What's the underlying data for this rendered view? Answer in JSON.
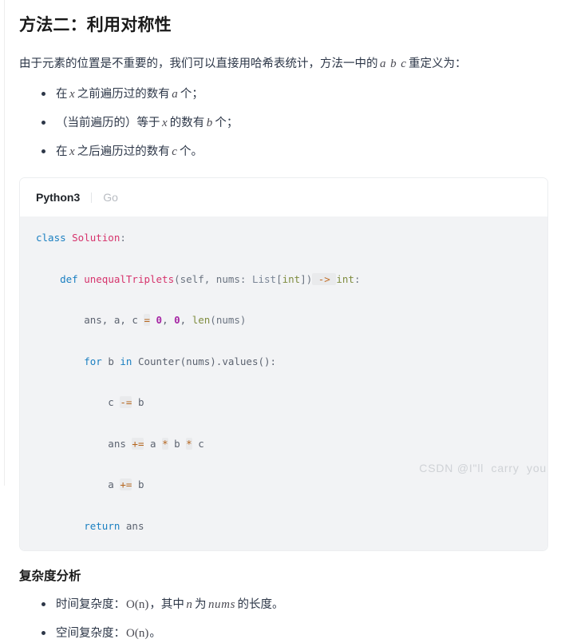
{
  "article": {
    "heading": "方法二：利用对称性",
    "intro": {
      "before": "由于元素的位置是不重要的，我们可以直接用哈希表统计，方法一中的",
      "math_a": "a",
      "math_b": "b",
      "math_c": "c",
      "after": "重定义为："
    },
    "definition_bullets": [
      {
        "p1": "在",
        "m1": "x",
        "p2": "之前遍历过的数有",
        "m2": "a",
        "p3": "个；"
      },
      {
        "p1": "（当前遍历的）等于",
        "m1": "x",
        "p2": "的数有",
        "m2": "b",
        "p3": "个；"
      },
      {
        "p1": "在",
        "m1": "x",
        "p2": "之后遍历过的数有",
        "m2": "c",
        "p3": "个。"
      }
    ]
  },
  "code_card": {
    "tabs": [
      {
        "label": "Python3",
        "active": true
      },
      {
        "label": "Go",
        "active": false
      }
    ],
    "language": "Python3",
    "lines": [
      [
        {
          "t": "class ",
          "c": "kw"
        },
        {
          "t": "Solution",
          "c": "cls"
        },
        {
          "t": ":",
          "c": "punc"
        }
      ],
      [
        {
          "t": "    ",
          "c": "plain"
        },
        {
          "t": "def ",
          "c": "kw"
        },
        {
          "t": "unequalTriplets",
          "c": "fn"
        },
        {
          "t": "(",
          "c": "punc"
        },
        {
          "t": "self",
          "c": "param"
        },
        {
          "t": ", nums: ",
          "c": "punc"
        },
        {
          "t": "List",
          "c": "typ"
        },
        {
          "t": "[",
          "c": "punc"
        },
        {
          "t": "int",
          "c": "builtin"
        },
        {
          "t": "])",
          "c": "punc"
        },
        {
          "t": " -> ",
          "c": "arrow"
        },
        {
          "t": "int",
          "c": "builtin"
        },
        {
          "t": ":",
          "c": "punc"
        }
      ],
      [
        {
          "t": "        ans, a, c ",
          "c": "plain"
        },
        {
          "t": "=",
          "c": "op"
        },
        {
          "t": " ",
          "c": "plain"
        },
        {
          "t": "0",
          "c": "num"
        },
        {
          "t": ", ",
          "c": "plain"
        },
        {
          "t": "0",
          "c": "num"
        },
        {
          "t": ", ",
          "c": "plain"
        },
        {
          "t": "len",
          "c": "builtin"
        },
        {
          "t": "(nums)",
          "c": "punc"
        }
      ],
      [
        {
          "t": "        ",
          "c": "plain"
        },
        {
          "t": "for ",
          "c": "kw"
        },
        {
          "t": "b ",
          "c": "plain"
        },
        {
          "t": "in ",
          "c": "kw"
        },
        {
          "t": "Counter(nums).values():",
          "c": "plain"
        }
      ],
      [
        {
          "t": "            c ",
          "c": "plain"
        },
        {
          "t": "-=",
          "c": "op"
        },
        {
          "t": " b",
          "c": "plain"
        }
      ],
      [
        {
          "t": "            ans ",
          "c": "plain"
        },
        {
          "t": "+=",
          "c": "op"
        },
        {
          "t": " a ",
          "c": "plain"
        },
        {
          "t": "*",
          "c": "op"
        },
        {
          "t": " b ",
          "c": "plain"
        },
        {
          "t": "*",
          "c": "op"
        },
        {
          "t": " c",
          "c": "plain"
        }
      ],
      [
        {
          "t": "            a ",
          "c": "plain"
        },
        {
          "t": "+=",
          "c": "op"
        },
        {
          "t": " b",
          "c": "plain"
        }
      ],
      [
        {
          "t": "        ",
          "c": "plain"
        },
        {
          "t": "return ",
          "c": "kw"
        },
        {
          "t": "ans",
          "c": "plain"
        }
      ]
    ]
  },
  "complexity": {
    "heading": "复杂度分析",
    "bullets": [
      {
        "p1": "时间复杂度：",
        "m1": "O(n)",
        "p2": "，其中",
        "m2": "n",
        "p3": "为",
        "m3": "nums",
        "p4": "的长度。"
      },
      {
        "p1": "空间复杂度：",
        "m1": "O(n)",
        "p2": "。"
      }
    ]
  },
  "watermark": {
    "text": "CSDN @I\"ll  carry  you"
  },
  "colors": {
    "heading": "#1a1a1a",
    "body_text": "#2d3748",
    "code_bg": "#f2f3f5",
    "card_border": "#eceef0",
    "tab_active": "#1f2328",
    "tab_inactive": "#b8bcc2",
    "watermark": "#cfd2d6"
  }
}
